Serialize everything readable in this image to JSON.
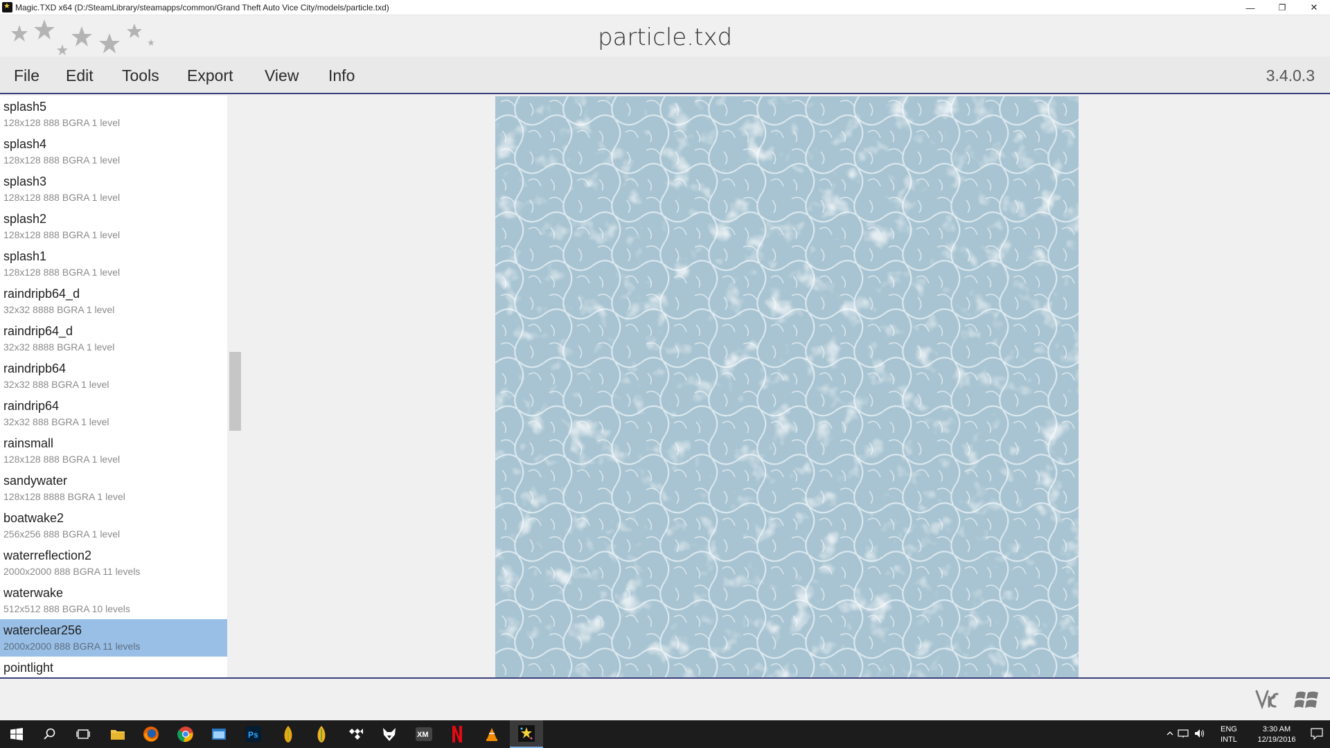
{
  "window": {
    "title": "Magic.TXD x64 (D:/SteamLibrary/steamapps/common/Grand Theft Auto Vice City/models/particle.txd)",
    "minimize": "—",
    "restore": "❐",
    "close": "✕"
  },
  "header": {
    "file_title": "particle.txd"
  },
  "menu": {
    "items": [
      "File",
      "Edit",
      "Tools",
      "Export",
      "View",
      "Info"
    ],
    "version": "3.4.0.3"
  },
  "textures": [
    {
      "name": "splash5",
      "info": "128x128 888 BGRA 1 level"
    },
    {
      "name": "splash4",
      "info": "128x128 888 BGRA 1 level"
    },
    {
      "name": "splash3",
      "info": "128x128 888 BGRA 1 level"
    },
    {
      "name": "splash2",
      "info": "128x128 888 BGRA 1 level"
    },
    {
      "name": "splash1",
      "info": "128x128 888 BGRA 1 level"
    },
    {
      "name": "raindripb64_d",
      "info": "32x32 8888 BGRA 1 level"
    },
    {
      "name": "raindrip64_d",
      "info": "32x32 8888 BGRA 1 level"
    },
    {
      "name": "raindripb64",
      "info": "32x32 888 BGRA 1 level"
    },
    {
      "name": "raindrip64",
      "info": "32x32 888 BGRA 1 level"
    },
    {
      "name": "rainsmall",
      "info": "128x128 888 BGRA 1 level"
    },
    {
      "name": "sandywater",
      "info": "128x128 8888 BGRA 1 level"
    },
    {
      "name": "boatwake2",
      "info": "256x256 888 BGRA 1 level"
    },
    {
      "name": "waterreflection2",
      "info": "2000x2000 888 BGRA 11 levels"
    },
    {
      "name": "waterwake",
      "info": "512x512 888 BGRA 10 levels"
    },
    {
      "name": "waterclear256",
      "info": "2000x2000 888 BGRA 11 levels",
      "selected": true
    },
    {
      "name": "pointlight",
      "info": ""
    }
  ],
  "preview": {
    "texture": "waterclear256",
    "tint": "#a8c4d2"
  },
  "taskbar": {
    "apps": [
      "windows-start-icon",
      "search-icon",
      "task-view-icon",
      "file-explorer-icon",
      "firefox-icon",
      "chrome-icon",
      "window-app-icon",
      "photoshop-icon",
      "fl-studio-icon",
      "fl-studio-icon-2",
      "tidal-icon",
      "fox-head-icon",
      "xm-icon",
      "netflix-icon",
      "vlc-icon",
      "magic-txd-icon"
    ],
    "photoshop_label": "Ps",
    "xm_label": "XM",
    "lang_line1": "ENG",
    "lang_line2": "INTL",
    "time": "3:30 AM",
    "date": "12/19/2016"
  },
  "colors": {
    "accent_line": "#3a3f7a",
    "selection": "#99bfe6"
  }
}
